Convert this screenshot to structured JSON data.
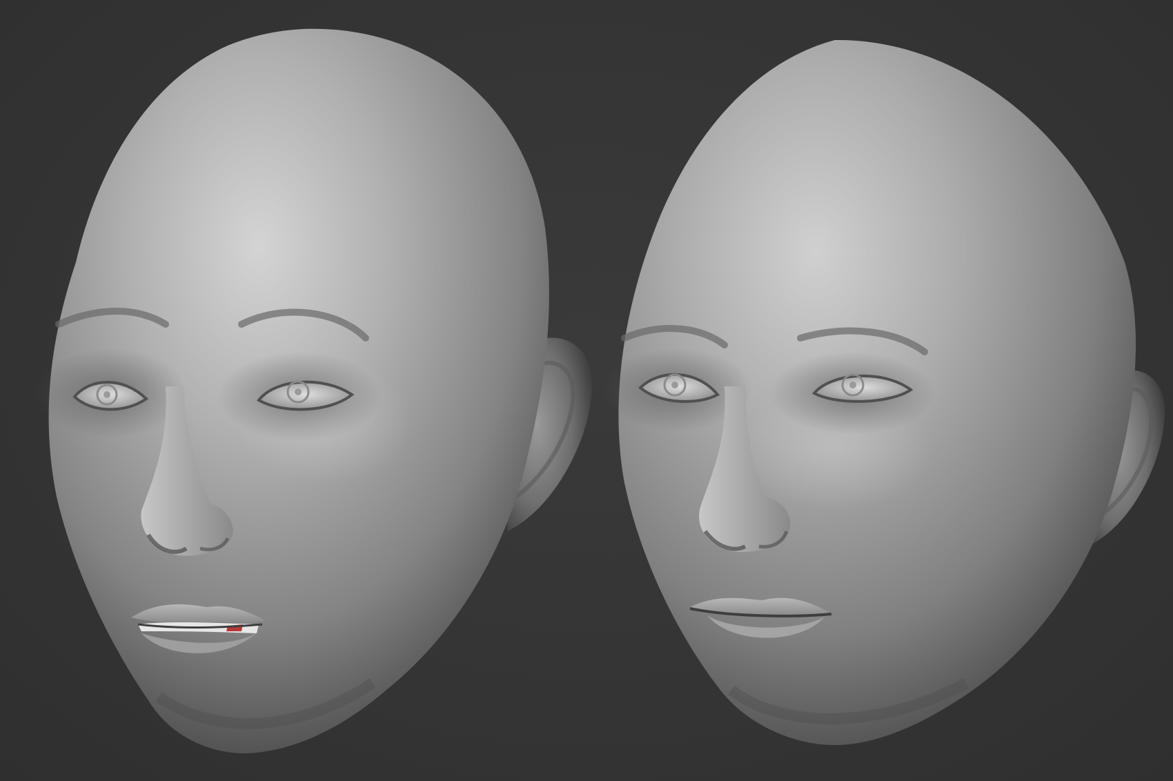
{
  "scene": {
    "background_color": "#353535",
    "clay_color": "#9a9a9a",
    "highlight_color": "#d2d2d2",
    "shadow_color": "#3e3e3e",
    "lip_accent_color": "#b01818"
  },
  "heads": [
    {
      "id": "head-left",
      "label": "",
      "expression": "lips-parted"
    },
    {
      "id": "head-right",
      "label": "",
      "expression": "lips-closed"
    }
  ]
}
